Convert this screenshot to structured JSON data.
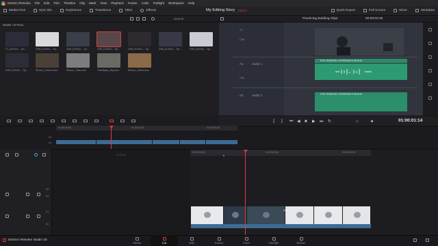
{
  "menubar": {
    "app_name": "DaVinci Resolve",
    "items": [
      "File",
      "Edit",
      "Trim",
      "Timeline",
      "Clip",
      "Mark",
      "View",
      "Playback",
      "Fusion",
      "Color",
      "Fairlight",
      "Workspace",
      "Help"
    ]
  },
  "toolbar": {
    "media_pool": "Media Pool",
    "sync_bin": "Sync Bin",
    "keyframes": "Keyframes",
    "transitions": "Transitions",
    "titles": "Titles",
    "effects": "Effects",
    "project_title": "My Editing Story",
    "edited_badge": "Edited",
    "quick_export": "Quick Export",
    "full_screen": "Full Screen",
    "mixer": "Mixer",
    "metadata": "Metadata"
  },
  "subbar": {
    "search_label": "Search",
    "sequence_name": "Practicing Building Clips",
    "source_timecode": "00:00:04:25"
  },
  "media_pool": {
    "breadcrumb": "Master / B-ROLL",
    "clips": [
      {
        "name": "C1_B-ROLL - Gri...",
        "tone": "#2b2e3a"
      },
      {
        "name": "GH6_B-ROLL - Tip...",
        "tone": "#d9dadd"
      },
      {
        "name": "GH6_B-ROLL - Spo...",
        "tone": "#3a3e48"
      },
      {
        "name": "GH6_B-ROLL - Tip...",
        "tone": "#5a4548"
      },
      {
        "name": "GH6_B-ROLL - Tip...",
        "tone": "#2e2a30"
      },
      {
        "name": "GH6_B-ROLL - Tip...",
        "tone": "#373a46"
      },
      {
        "name": "GH6_B-ROLL - Tip...",
        "tone": "#c9ccd2"
      },
      {
        "name": "GH6_B-ROLL - Tip...",
        "tone": "#2a2d36"
      },
      {
        "name": "iPhone_Church.mov",
        "tone": "#4a4038"
      },
      {
        "name": "iPhone_Train.mov",
        "tone": "#7a7c80"
      },
      {
        "name": "Timelapse_Sky.mov",
        "tone": "#6a6a64"
      },
      {
        "name": "iPhone_Street.mov",
        "tone": "#8a6a48"
      }
    ]
  },
  "viewer": {
    "track_a1": "A1",
    "audio_1": "Audio 1",
    "track_a2": "A2",
    "audio_2": "Audio 2",
    "clip_label": "Clip",
    "clip_banner_1": "PRE-TENDERS / ESPERANCE BONUS",
    "clip_banner_2": "PRE-TENDERS / ESPERANCE BONUS"
  },
  "transport": {
    "timecode": "01:00:01:14"
  },
  "upper_timeline": {
    "ruler": [
      "01:00:00:00",
      "01:00:02:00",
      "01:00:04:00"
    ],
    "tracks": [
      "V1",
      "A1"
    ]
  },
  "lower_timeline": {
    "ruler": [
      "01:00:00:00",
      "01:00:02:00",
      "01:00:03:00"
    ],
    "gap_label": "00:00:00",
    "track_labels": [
      "A2",
      "A1",
      "V1",
      "A1"
    ]
  },
  "pages": [
    {
      "label": "Media",
      "active": false
    },
    {
      "label": "Cut",
      "active": true
    },
    {
      "label": "Edit",
      "active": false
    },
    {
      "label": "Fusion",
      "active": false
    },
    {
      "label": "Color",
      "active": false
    },
    {
      "label": "Fairlight",
      "active": false
    },
    {
      "label": "Deliver",
      "active": false
    }
  ],
  "footer": {
    "version": "DaVinci Resolve Studio 20"
  },
  "colors": {
    "accent_red": "#e03a3a",
    "track_blue": "#3d6b94",
    "audio_green": "#2e9a72"
  }
}
